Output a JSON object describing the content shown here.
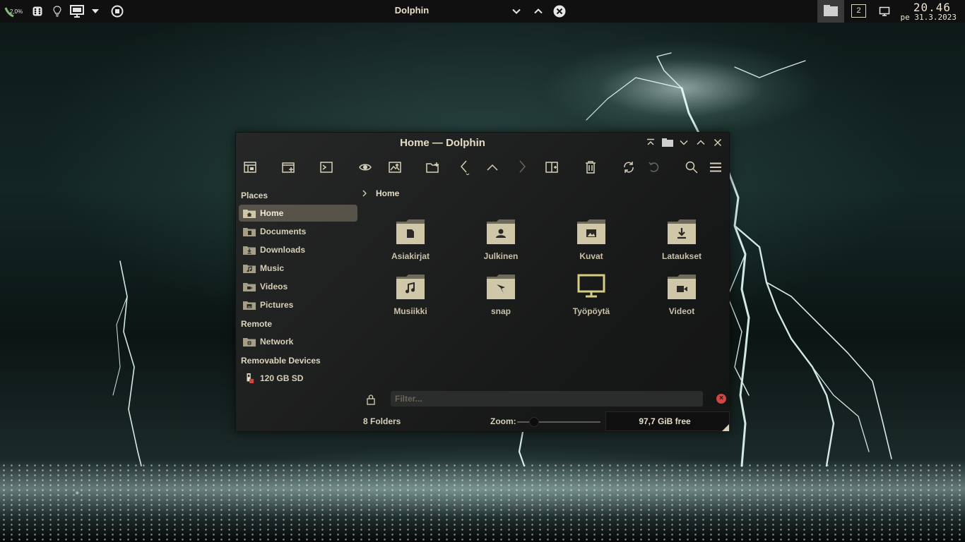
{
  "panel": {
    "cpu_label": "2,0%",
    "active_window_title": "Dolphin",
    "pager_number": "2",
    "clock_time": "20.46",
    "clock_date": "pe 31.3.2023"
  },
  "window": {
    "title": "Home — Dolphin"
  },
  "sidebar": {
    "sections": {
      "places": "Places",
      "remote": "Remote",
      "removable": "Removable Devices"
    },
    "places": [
      {
        "label": "Home",
        "icon": "home-folder-icon",
        "active": true
      },
      {
        "label": "Documents",
        "icon": "documents-folder-icon"
      },
      {
        "label": "Downloads",
        "icon": "downloads-folder-icon"
      },
      {
        "label": "Music",
        "icon": "music-folder-icon"
      },
      {
        "label": "Videos",
        "icon": "videos-folder-icon"
      },
      {
        "label": "Pictures",
        "icon": "pictures-folder-icon"
      }
    ],
    "remote": [
      {
        "label": "Network",
        "icon": "network-folder-icon"
      }
    ],
    "removable": [
      {
        "label": "120 GB SD",
        "icon": "sd-card-icon"
      }
    ]
  },
  "breadcrumb": {
    "current": "Home"
  },
  "folders": [
    {
      "name": "Asiakirjat",
      "icon": "document-folder-icon"
    },
    {
      "name": "Julkinen",
      "icon": "public-folder-icon"
    },
    {
      "name": "Kuvat",
      "icon": "pictures-folder-icon"
    },
    {
      "name": "Lataukset",
      "icon": "download-folder-icon"
    },
    {
      "name": "Musiikki",
      "icon": "music-folder-icon"
    },
    {
      "name": "snap",
      "icon": "snap-folder-icon"
    },
    {
      "name": "Työpöytä",
      "icon": "desktop-icon"
    },
    {
      "name": "Videot",
      "icon": "video-folder-icon"
    }
  ],
  "filter": {
    "placeholder": "Filter..."
  },
  "statusbar": {
    "count": "8 Folders",
    "zoom_label": "Zoom:",
    "zoom_level": 0.2,
    "free_space": "97,7 GiB free"
  },
  "colors": {
    "accent": "#d7d0b7",
    "folder": "#cfc7a8",
    "active_place_bg": "#57534b",
    "clear_button": "#d04545"
  }
}
